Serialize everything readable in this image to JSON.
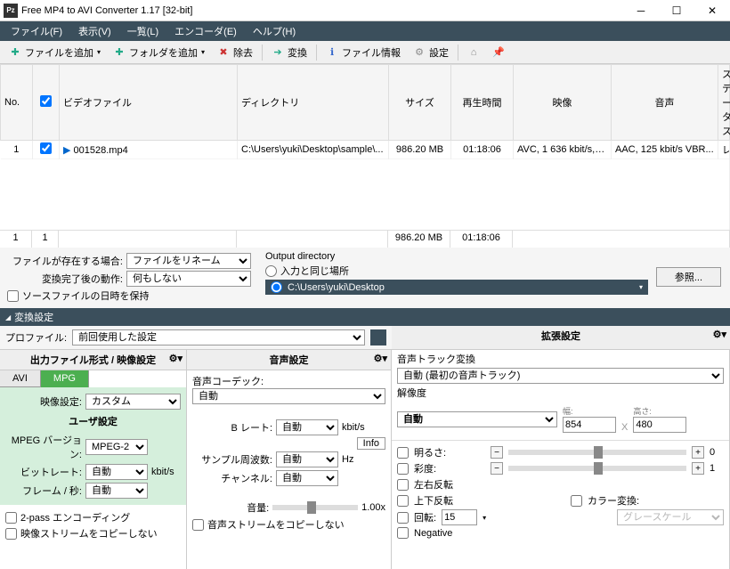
{
  "window": {
    "icon_text": "Pz",
    "title": "Free MP4 to AVI Converter 1.17  [32-bit]"
  },
  "menu": [
    "ファイル(F)",
    "表示(V)",
    "一覧(L)",
    "エンコーダ(E)",
    "ヘルプ(H)"
  ],
  "toolbar": {
    "add_file": "ファイルを追加",
    "add_folder": "フォルダを追加",
    "remove": "除去",
    "convert": "変換",
    "file_info": "ファイル情報",
    "settings": "設定"
  },
  "grid": {
    "headers": [
      "No.",
      "☑",
      "ビデオファイル",
      "ディレクトリ",
      "サイズ",
      "再生時間",
      "映像",
      "音声",
      "ステータス"
    ],
    "rows": [
      {
        "no": "1",
        "checked": true,
        "file": "001528.mp4",
        "dir": "C:\\Users\\yuki\\Desktop\\sample\\...",
        "size": "986.20 MB",
        "duration": "01:18:06",
        "video": "AVC, 1 636 kbit/s, 1 ...",
        "audio": "AAC, 125 kbit/s VBR...",
        "status": "レディ"
      }
    ],
    "footer": {
      "count1": "1",
      "count2": "1",
      "total_size": "986.20 MB",
      "total_dur": "01:18:06"
    }
  },
  "middle": {
    "exist_label": "ファイルが存在する場合:",
    "exist_value": "ファイルをリネーム",
    "after_label": "変換完了後の動作:",
    "after_value": "何もしない",
    "keep_timestamp": "ソースファイルの日時を保持",
    "output_label": "Output directory",
    "same_as_input": "入力と同じ場所",
    "custom_path": "C:\\Users\\yuki\\Desktop",
    "browse": "参照..."
  },
  "conversion_header": "変換設定",
  "profile": {
    "label": "プロファイル:",
    "value": "前回使用した設定"
  },
  "col1": {
    "title": "出力ファイル形式 / 映像設定",
    "tab_avi": "AVI",
    "tab_mpg": "MPG",
    "video_setting_label": "映像設定:",
    "video_setting_value": "カスタム",
    "user_title": "ユーザ設定",
    "mpeg_ver_label": "MPEG バージョン:",
    "mpeg_ver_value": "MPEG-2",
    "bitrate_label": "ビットレート:",
    "bitrate_value": "自動",
    "bitrate_unit": "kbit/s",
    "fps_label": "フレーム / 秒:",
    "fps_value": "自動",
    "twopass": "2-pass エンコーディング",
    "no_copy_video": "映像ストリームをコピーしない"
  },
  "col2": {
    "title": "音声設定",
    "codec_label": "音声コーデック:",
    "codec_value": "自動",
    "b_rate_label": "B レート:",
    "b_rate_value": "自動",
    "b_rate_unit": "kbit/s",
    "info": "Info",
    "sample_label": "サンプル周波数:",
    "sample_value": "自動",
    "sample_unit": "Hz",
    "channel_label": "チャンネル:",
    "channel_value": "自動",
    "volume_label": "音量:",
    "volume_value": "1.00x",
    "no_copy_audio": "音声ストリームをコピーしない"
  },
  "col3": {
    "title": "拡張設定",
    "audio_track_label": "音声トラック変換",
    "audio_track_value": "自動 (最初の音声トラック)",
    "resolution_label": "解像度",
    "resolution_value": "自動",
    "width_label": "幅:",
    "width_value": "854",
    "x": "X",
    "height_label": "高さ:",
    "height_value": "480",
    "brightness": "明るさ:",
    "brightness_val": "0",
    "saturation": "彩度:",
    "saturation_val": "1",
    "flip_h": "左右反転",
    "flip_v": "上下反転",
    "color_conv": "カラー変換:",
    "color_conv_value": "グレースケール",
    "rotate": "回転:",
    "rotate_value": "15",
    "negative": "Negative"
  }
}
